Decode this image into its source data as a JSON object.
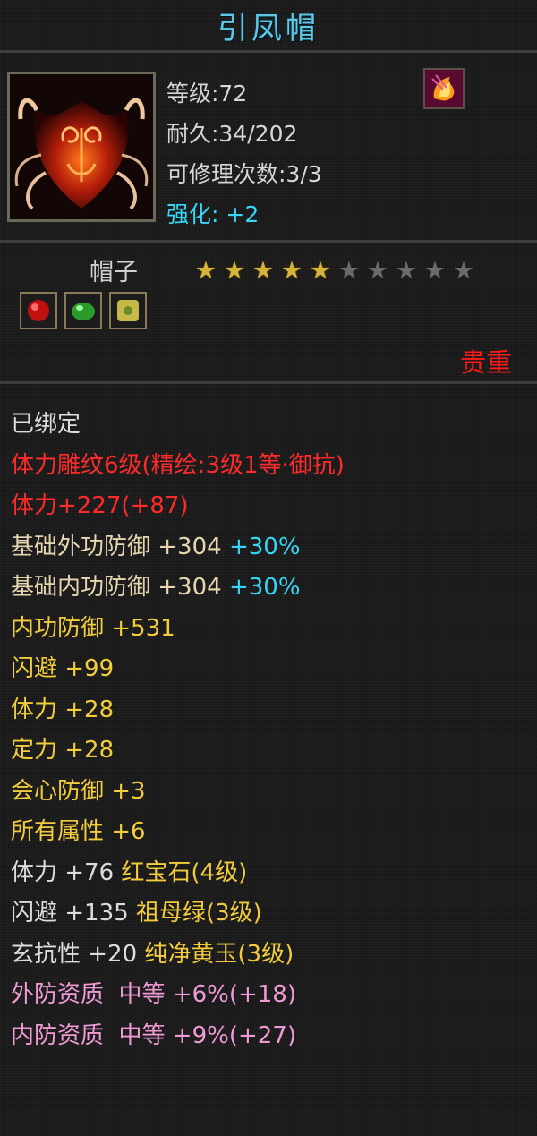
{
  "item": {
    "name": "引凤帽",
    "level": "等级:72",
    "durability": "耐久:34/202",
    "repairs": "可修理次数:3/3",
    "enhance_label": "强化:",
    "enhance_value": "+2",
    "type": "帽子",
    "stars_filled": 5,
    "stars_total": 10,
    "rarity": "贵重",
    "gems": [
      "red-gem-icon",
      "green-gem-icon",
      "yellow-jade-icon"
    ]
  },
  "stats": {
    "bound": "已绑定",
    "engrave": "体力雕纹6级(精绘:3级1等·御抗)",
    "stamina_bonus": "体力+227(+87)",
    "basic_ext_def": "基础外功防御 +304",
    "basic_ext_def_pct": "+30%",
    "basic_int_def": "基础内功防御 +304",
    "basic_int_def_pct": "+30%",
    "int_def": "内功防御 +531",
    "dodge": "闪避 +99",
    "stamina": "体力 +28",
    "focus": "定力 +28",
    "crit_def": "会心防御 +3",
    "all_attr": "所有属性 +6",
    "gem_stamina": "体力 +76",
    "gem_stamina_name": "红宝石(4级)",
    "gem_dodge": "闪避 +135",
    "gem_dodge_name": "祖母绿(3级)",
    "gem_resist": "玄抗性 +20",
    "gem_resist_name": "纯净黄玉(3级)",
    "ext_quality": "外防资质  中等 +6%(+18)",
    "int_quality": "内防资质  中等 +9%(+27)"
  },
  "colors": {
    "title": "#5fc6e6",
    "enhance": "#36d6f6",
    "rarity": "#ff1a1a",
    "engrave": "#ff2a2a",
    "basic": "#e6d6b0",
    "attribute": "#f2cc3a",
    "quality": "#f09ad6",
    "star_on": "#d6b43c",
    "star_off": "#6a6a6a"
  }
}
